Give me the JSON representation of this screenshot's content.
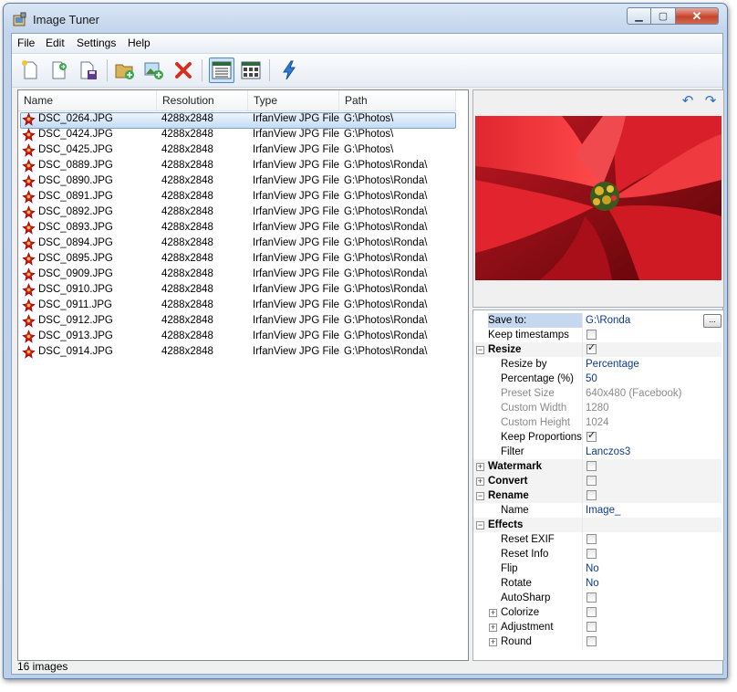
{
  "window": {
    "title": "Image Tuner"
  },
  "menu": [
    "File",
    "Edit",
    "Settings",
    "Help"
  ],
  "toolbar": {
    "buttons": [
      "new-icon",
      "open-icon",
      "save-icon",
      "add-folder-icon",
      "add-images-icon",
      "remove-icon",
      "details-view-icon",
      "thumbnails-view-icon",
      "process-icon"
    ]
  },
  "file_list": {
    "columns": [
      "Name",
      "Resolution",
      "Type",
      "Path"
    ],
    "rows": [
      {
        "name": "DSC_0264.JPG",
        "resolution": "4288x2848",
        "type": "IrfanView JPG File",
        "path": "G:\\Photos\\"
      },
      {
        "name": "DSC_0424.JPG",
        "resolution": "4288x2848",
        "type": "IrfanView JPG File",
        "path": "G:\\Photos\\"
      },
      {
        "name": "DSC_0425.JPG",
        "resolution": "4288x2848",
        "type": "IrfanView JPG File",
        "path": "G:\\Photos\\"
      },
      {
        "name": "DSC_0889.JPG",
        "resolution": "4288x2848",
        "type": "IrfanView JPG File",
        "path": "G:\\Photos\\Ronda\\"
      },
      {
        "name": "DSC_0890.JPG",
        "resolution": "4288x2848",
        "type": "IrfanView JPG File",
        "path": "G:\\Photos\\Ronda\\"
      },
      {
        "name": "DSC_0891.JPG",
        "resolution": "4288x2848",
        "type": "IrfanView JPG File",
        "path": "G:\\Photos\\Ronda\\"
      },
      {
        "name": "DSC_0892.JPG",
        "resolution": "4288x2848",
        "type": "IrfanView JPG File",
        "path": "G:\\Photos\\Ronda\\"
      },
      {
        "name": "DSC_0893.JPG",
        "resolution": "4288x2848",
        "type": "IrfanView JPG File",
        "path": "G:\\Photos\\Ronda\\"
      },
      {
        "name": "DSC_0894.JPG",
        "resolution": "4288x2848",
        "type": "IrfanView JPG File",
        "path": "G:\\Photos\\Ronda\\"
      },
      {
        "name": "DSC_0895.JPG",
        "resolution": "4288x2848",
        "type": "IrfanView JPG File",
        "path": "G:\\Photos\\Ronda\\"
      },
      {
        "name": "DSC_0909.JPG",
        "resolution": "4288x2848",
        "type": "IrfanView JPG File",
        "path": "G:\\Photos\\Ronda\\"
      },
      {
        "name": "DSC_0910.JPG",
        "resolution": "4288x2848",
        "type": "IrfanView JPG File",
        "path": "G:\\Photos\\Ronda\\"
      },
      {
        "name": "DSC_0911.JPG",
        "resolution": "4288x2848",
        "type": "IrfanView JPG File",
        "path": "G:\\Photos\\Ronda\\"
      },
      {
        "name": "DSC_0912.JPG",
        "resolution": "4288x2848",
        "type": "IrfanView JPG File",
        "path": "G:\\Photos\\Ronda\\"
      },
      {
        "name": "DSC_0913.JPG",
        "resolution": "4288x2848",
        "type": "IrfanView JPG File",
        "path": "G:\\Photos\\Ronda\\"
      },
      {
        "name": "DSC_0914.JPG",
        "resolution": "4288x2848",
        "type": "IrfanView JPG File",
        "path": "G:\\Photos\\Ronda\\"
      }
    ],
    "selected_index": 0
  },
  "preview": {
    "undo_icon": "undo-icon",
    "redo_icon": "redo-icon"
  },
  "properties": [
    {
      "label": "Save to:",
      "value": "G:\\Ronda",
      "kind": "text",
      "level": 0,
      "highlight": true,
      "browse": "..."
    },
    {
      "label": "Keep timestamps",
      "kind": "check",
      "checked": false,
      "level": 0
    },
    {
      "label": "Resize",
      "kind": "check",
      "checked": true,
      "level": 0,
      "category": true,
      "expanded": true
    },
    {
      "label": "Resize by",
      "value": "Percentage",
      "kind": "text",
      "level": 1
    },
    {
      "label": "Percentage (%)",
      "value": "50",
      "kind": "text",
      "level": 1
    },
    {
      "label": "Preset Size",
      "value": "640x480 (Facebook)",
      "kind": "text",
      "level": 1,
      "disabled": true
    },
    {
      "label": "Custom Width",
      "value": "1280",
      "kind": "text",
      "level": 1,
      "disabled": true
    },
    {
      "label": "Custom Height",
      "value": "1024",
      "kind": "text",
      "level": 1,
      "disabled": true
    },
    {
      "label": "Keep Proportions",
      "kind": "check",
      "checked": true,
      "level": 1
    },
    {
      "label": "Filter",
      "value": "Lanczos3",
      "kind": "text",
      "level": 1
    },
    {
      "label": "Watermark",
      "kind": "check",
      "checked": false,
      "level": 0,
      "category": true,
      "expanded": false
    },
    {
      "label": "Convert",
      "kind": "check",
      "checked": false,
      "level": 0,
      "category": true,
      "expanded": false
    },
    {
      "label": "Rename",
      "kind": "check",
      "checked": false,
      "level": 0,
      "category": true,
      "expanded": true
    },
    {
      "label": "Name",
      "value": "Image_",
      "kind": "text",
      "level": 1
    },
    {
      "label": "Effects",
      "kind": "none",
      "level": 0,
      "category": true,
      "expanded": true
    },
    {
      "label": "Reset EXIF",
      "kind": "check",
      "checked": false,
      "level": 1
    },
    {
      "label": "Reset Info",
      "kind": "check",
      "checked": false,
      "level": 1
    },
    {
      "label": "Flip",
      "value": "No",
      "kind": "text",
      "level": 1
    },
    {
      "label": "Rotate",
      "value": "No",
      "kind": "text",
      "level": 1
    },
    {
      "label": "AutoSharp",
      "kind": "check",
      "checked": false,
      "level": 1
    },
    {
      "label": "Colorize",
      "kind": "check",
      "checked": false,
      "level": 1,
      "subcategory": true
    },
    {
      "label": "Adjustment",
      "kind": "check",
      "checked": false,
      "level": 1,
      "subcategory": true
    },
    {
      "label": "Round",
      "kind": "check",
      "checked": false,
      "level": 1,
      "subcategory": true
    }
  ],
  "status": {
    "text": "16 images"
  },
  "colors": {
    "accent": "#2a6fc4",
    "selection": "#c2dcf5",
    "remove": "#d3301f"
  }
}
